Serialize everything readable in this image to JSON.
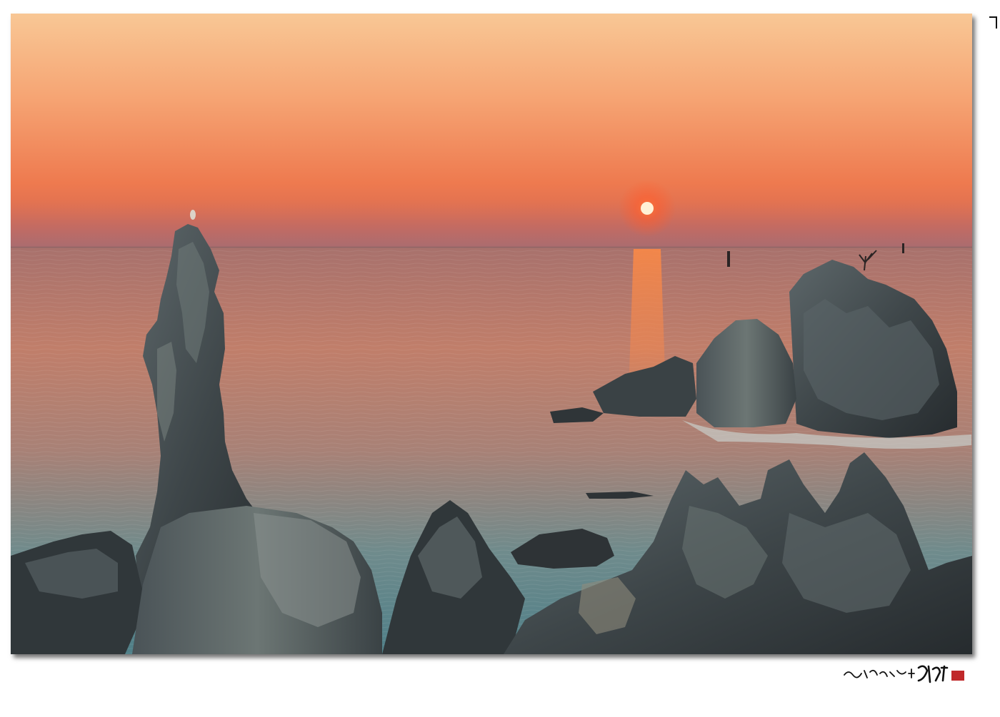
{
  "photo": {
    "subject": "sunset-over-sea-with-rock-formations"
  },
  "colors": {
    "sky_top": "#f7c08c",
    "sky_mid": "#f3915a",
    "sky_horizon": "#e06a4a",
    "haze": "#c9736a",
    "sun": "#ffe9c6",
    "sun_glow": "#ff5a2a",
    "sea_far": "#b07a70",
    "sea_near": "#5e8b92",
    "rock_dark": "#2f3538",
    "rock_mid": "#4c5659",
    "rock_light": "#7c8684"
  },
  "signature": {
    "stamp_color": "#c0282a",
    "ink_color": "#111111"
  }
}
